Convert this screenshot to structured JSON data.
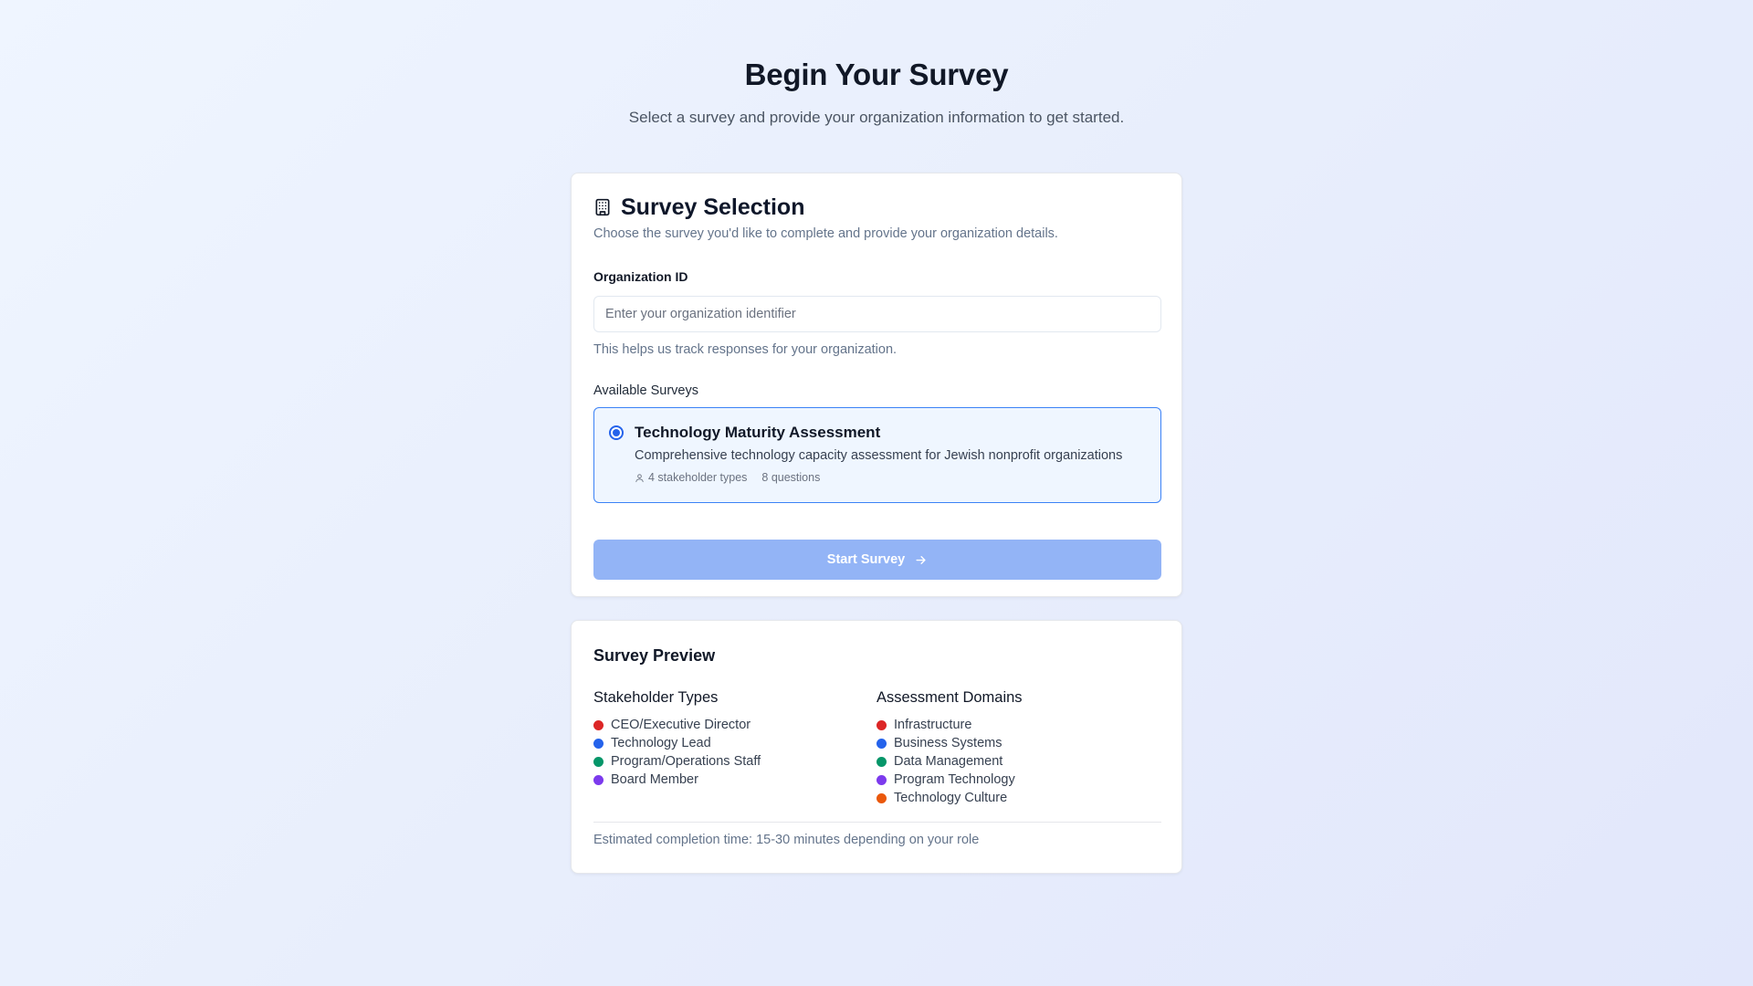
{
  "hero": {
    "title": "Begin Your Survey",
    "subtitle": "Select a survey and provide your organization information to get started."
  },
  "selection": {
    "icon": "building-icon",
    "title": "Survey Selection",
    "description": "Choose the survey you'd like to complete and provide your organization details.",
    "org_label": "Organization ID",
    "org_value": "",
    "org_placeholder": "Enter your organization identifier",
    "org_help": "This helps us track responses for your organization.",
    "surveys_label": "Available Surveys",
    "surveys": [
      {
        "title": "Technology Maturity Assessment",
        "description": "Comprehensive technology capacity assessment for Jewish nonprofit organizations",
        "stakeholders": "4 stakeholder types",
        "questions": "8 questions",
        "selected": true
      }
    ],
    "start_label": "Start Survey",
    "start_icon": "arrow-right-icon"
  },
  "preview": {
    "title": "Survey Preview",
    "stakeholder_heading": "Stakeholder Types",
    "stakeholders": [
      {
        "label": "CEO/Executive Director",
        "color": "#dc2626"
      },
      {
        "label": "Technology Lead",
        "color": "#2563eb"
      },
      {
        "label": "Program/Operations Staff",
        "color": "#059669"
      },
      {
        "label": "Board Member",
        "color": "#7c3aed"
      }
    ],
    "domains_heading": "Assessment Domains",
    "domains": [
      {
        "label": "Infrastructure",
        "color": "#dc2626"
      },
      {
        "label": "Business Systems",
        "color": "#2563eb"
      },
      {
        "label": "Data Management",
        "color": "#059669"
      },
      {
        "label": "Program Technology",
        "color": "#7c3aed"
      },
      {
        "label": "Technology Culture",
        "color": "#ea580c"
      }
    ],
    "estimate": "Estimated completion time: 15-30 minutes depending on your role"
  }
}
